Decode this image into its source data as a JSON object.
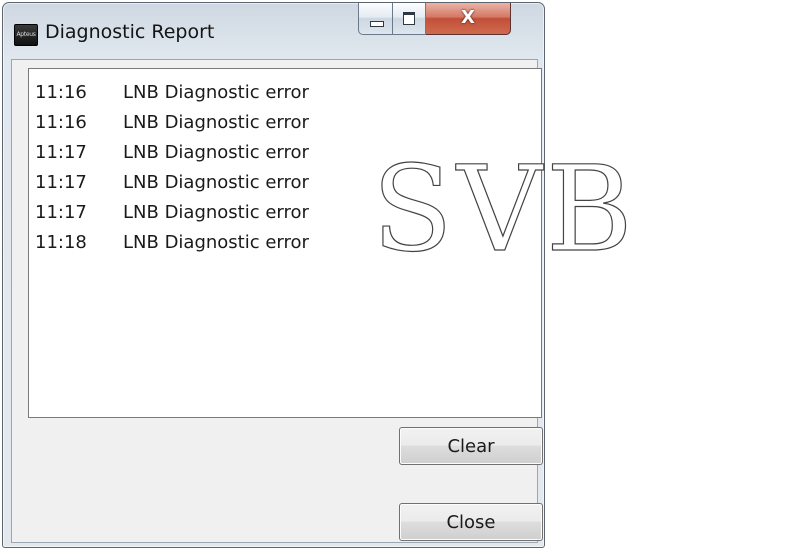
{
  "window": {
    "title": "Diagnostic Report",
    "app_icon_text": "Apteus",
    "close_glyph": "X"
  },
  "log": {
    "entries": [
      {
        "time": "11:16",
        "message": "LNB Diagnostic error"
      },
      {
        "time": "11:16",
        "message": "LNB Diagnostic error"
      },
      {
        "time": "11:17",
        "message": "LNB Diagnostic error"
      },
      {
        "time": "11:17",
        "message": "LNB Diagnostic error"
      },
      {
        "time": "11:17",
        "message": "LNB Diagnostic error"
      },
      {
        "time": "11:18",
        "message": "LNB Diagnostic error"
      }
    ]
  },
  "buttons": {
    "clear_label": "Clear",
    "close_label": "Close"
  },
  "watermark": {
    "text": "SVB"
  }
}
